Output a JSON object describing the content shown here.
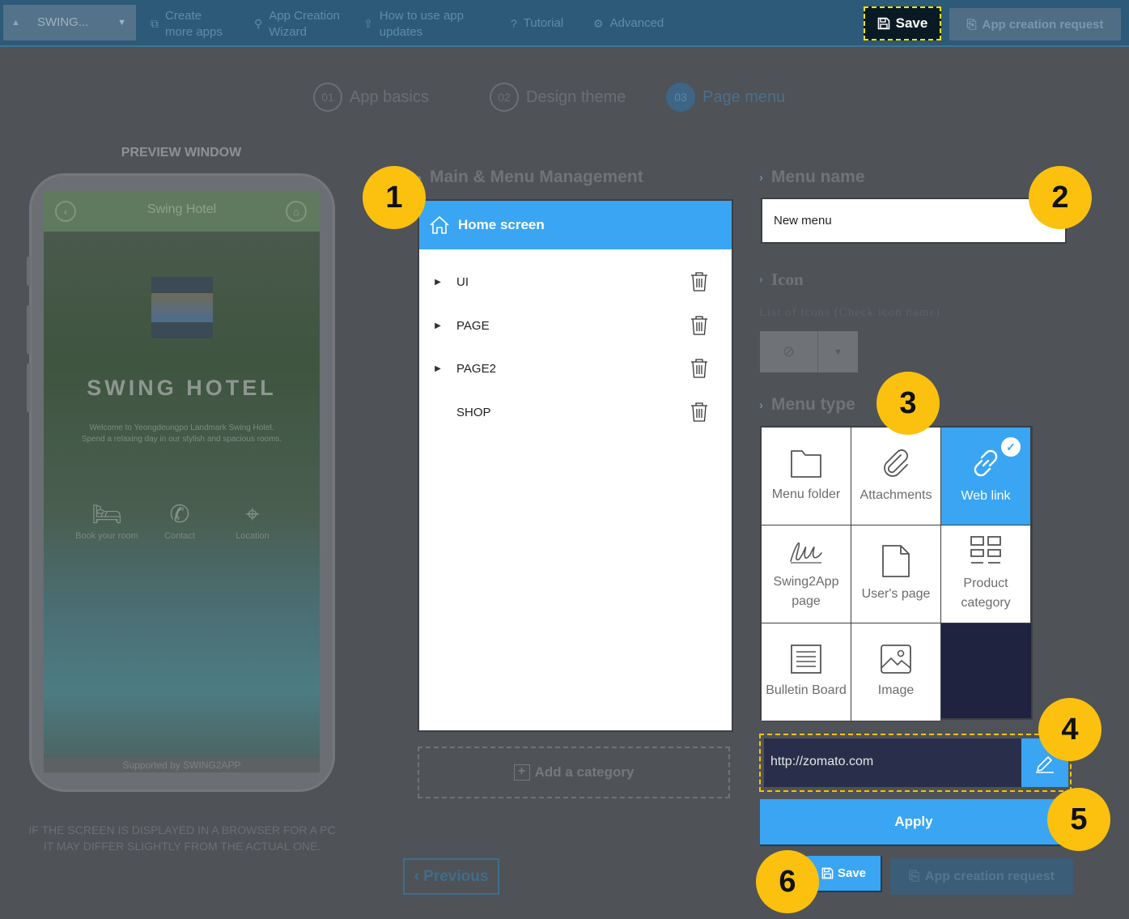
{
  "topbar": {
    "app_name": "SWING...",
    "links": [
      {
        "label_line1": "Create",
        "label_line2": "more apps",
        "icon": "copy-icon"
      },
      {
        "label_line1": "App Creation",
        "label_line2": "Wizard",
        "icon": "wand-icon"
      },
      {
        "label_line1": "How to use app",
        "label_line2": "updates",
        "icon": "upload-icon"
      },
      {
        "label": "Tutorial",
        "icon": "question-icon"
      },
      {
        "label": "Advanced",
        "icon": "gear-icon"
      }
    ],
    "save_label": "Save",
    "request_label": "App creation request"
  },
  "steps": [
    {
      "num": "01",
      "label": "App basics"
    },
    {
      "num": "02",
      "label": "Design theme"
    },
    {
      "num": "03",
      "label": "Page menu",
      "active": true
    }
  ],
  "preview": {
    "title": "PREVIEW WINDOW",
    "header_title": "Swing Hotel",
    "hotel_name": "SWING HOTEL",
    "welcome_line1": "Welcome to Yeongdeungpo Landmark Swing Hotel.",
    "welcome_line2": "Spend a relaxing day in our stylish and spacious rooms.",
    "quick_links": [
      "Book your room",
      "Contact",
      "Location"
    ],
    "support": "Supported by SWING2APP",
    "note_line1": "IF THE SCREEN IS DISPLAYED IN A BROWSER FOR A PC",
    "note_line2": "IT MAY DIFFER SLIGHTLY FROM THE ACTUAL ONE."
  },
  "menu": {
    "heading": "Main & Menu Management",
    "home_label": "Home screen",
    "items": [
      {
        "label": "UI",
        "expandable": true
      },
      {
        "label": "PAGE",
        "expandable": true
      },
      {
        "label": "PAGE2",
        "expandable": true
      },
      {
        "label": "SHOP",
        "expandable": false
      }
    ],
    "add_category": "Add a category",
    "previous": "Previous"
  },
  "settings": {
    "menu_name_heading": "Menu name",
    "menu_name_value": "New menu",
    "icon_heading": "Icon",
    "icon_sub": "List of icons (Check icon name)",
    "menu_type_heading": "Menu type",
    "menu_types": [
      {
        "label": "Menu folder",
        "icon": "folder-icon"
      },
      {
        "label": "Attachments",
        "icon": "paperclip-icon"
      },
      {
        "label": "Web link",
        "icon": "link-icon",
        "selected": true
      },
      {
        "label": "Swing2App page",
        "icon": "signature-icon"
      },
      {
        "label": "User's page",
        "icon": "page-icon"
      },
      {
        "label": "Product category",
        "icon": "grid-icon"
      },
      {
        "label": "Bulletin Board",
        "icon": "board-icon"
      },
      {
        "label": "Image",
        "icon": "image-icon"
      }
    ],
    "url_value": "http://zomato.com",
    "apply_label": "Apply",
    "save_label": "Save",
    "request_label": "App creation request"
  },
  "callouts": [
    "1",
    "2",
    "3",
    "4",
    "5",
    "6"
  ],
  "colors": {
    "accent": "#3aa5f3",
    "callout": "#fbc10e",
    "highlight_border": "#f5e400",
    "overlay_bg": "#4f5257"
  }
}
